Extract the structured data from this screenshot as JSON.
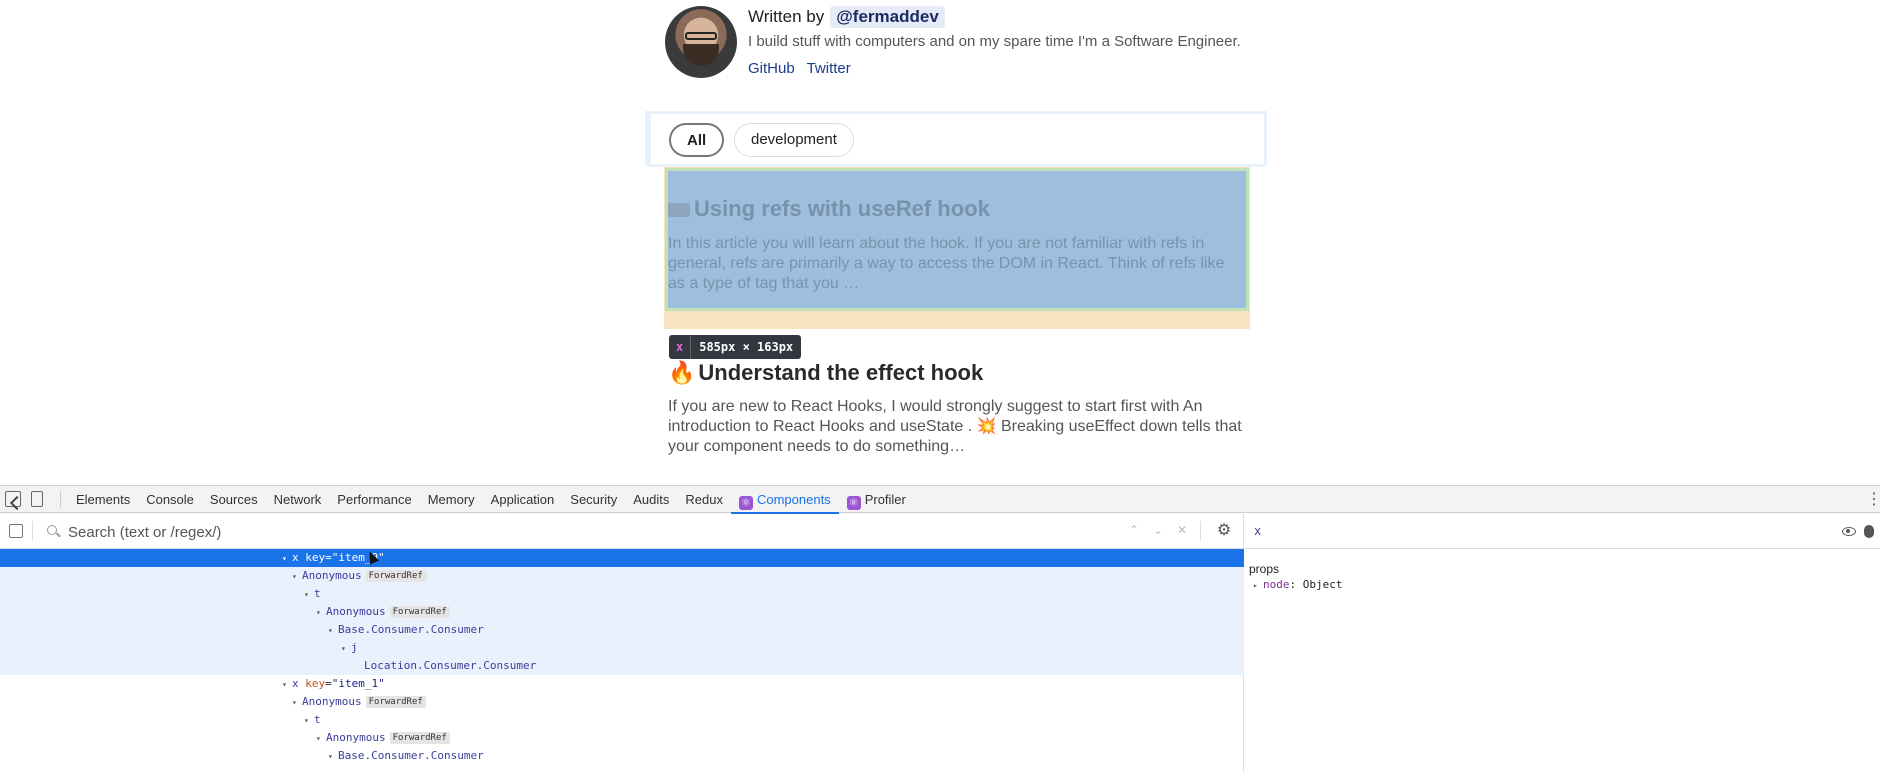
{
  "author": {
    "written_by": "Written by",
    "handle": "@fermaddev",
    "bio": "I build stuff with computers and on my spare time I'm a Software Engineer.",
    "links": [
      "GitHub",
      "Twitter"
    ]
  },
  "filters": {
    "all": "All",
    "development": "development"
  },
  "posts": [
    {
      "title": "Using refs with useRef hook",
      "excerpt": "In this article you will learn about the hook. If you are not familiar with refs in general, refs are primarily a way to access the DOM in React. Think of refs like as a type of tag that you …"
    },
    {
      "title": "Understand the effect hook",
      "excerpt": "If you are new to React Hooks, I would strongly suggest to start first with An introduction to React Hooks and useState . 💥 Breaking useEffect down tells that your component needs to do something…"
    }
  ],
  "inspector_tip": {
    "tag": "x",
    "dims": "585px × 163px"
  },
  "devtools": {
    "tabs": [
      "Elements",
      "Console",
      "Sources",
      "Network",
      "Performance",
      "Memory",
      "Application",
      "Security",
      "Audits",
      "Redux",
      "Components",
      "Profiler"
    ],
    "active_tab": "Components",
    "search_placeholder": "Search (text or /regex/)",
    "tree": [
      {
        "name": "x",
        "key_attr": "key",
        "key_val": "\"item_0\"",
        "badge": "",
        "state": "selected"
      },
      {
        "name": "Anonymous",
        "key_attr": "",
        "key_val": "",
        "badge": "ForwardRef",
        "state": "owned"
      },
      {
        "name": "t",
        "key_attr": "",
        "key_val": "",
        "badge": "",
        "state": "owned"
      },
      {
        "name": "Anonymous",
        "key_attr": "",
        "key_val": "",
        "badge": "ForwardRef",
        "state": "owned"
      },
      {
        "name": "Base.Consumer.Consumer",
        "key_attr": "",
        "key_val": "",
        "badge": "",
        "state": "owned"
      },
      {
        "name": "j",
        "key_attr": "",
        "key_val": "",
        "badge": "",
        "state": "owned"
      },
      {
        "name": "Location.Consumer.Consumer",
        "key_attr": "",
        "key_val": "",
        "badge": "",
        "state": "owned"
      },
      {
        "name": "x",
        "key_attr": "key",
        "key_val": "\"item_1\"",
        "badge": "",
        "state": "normal"
      },
      {
        "name": "Anonymous",
        "key_attr": "",
        "key_val": "",
        "badge": "ForwardRef",
        "state": "normal"
      },
      {
        "name": "t",
        "key_attr": "",
        "key_val": "",
        "badge": "",
        "state": "normal"
      },
      {
        "name": "Anonymous",
        "key_attr": "",
        "key_val": "",
        "badge": "ForwardRef",
        "state": "normal"
      },
      {
        "name": "Base.Consumer.Consumer",
        "key_attr": "",
        "key_val": "",
        "badge": "",
        "state": "normal"
      }
    ],
    "selected_component": "x",
    "props_label": "props",
    "prop": {
      "key": "node",
      "value": "Object"
    }
  }
}
